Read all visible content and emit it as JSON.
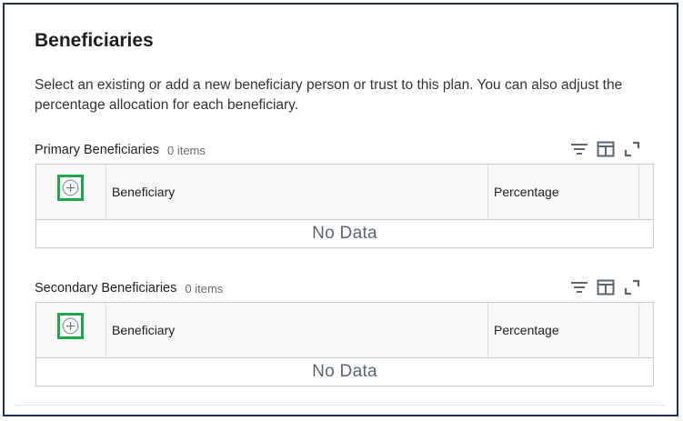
{
  "page": {
    "title": "Beneficiaries",
    "description": "Select an existing or add a new beneficiary person or trust to this plan. You can also adjust the percentage allocation for each beneficiary."
  },
  "primary": {
    "title": "Primary Beneficiaries",
    "count": "0 items",
    "columns": [
      "Beneficiary",
      "Percentage"
    ],
    "empty_text": "No Data"
  },
  "secondary": {
    "title": "Secondary Beneficiaries",
    "count": "0 items",
    "columns": [
      "Beneficiary",
      "Percentage"
    ],
    "empty_text": "No Data"
  },
  "icons": {
    "filter": "filter-icon",
    "columns": "columns-icon",
    "expand": "expand-icon",
    "add": "add-circle-icon"
  },
  "colors": {
    "frame_border": "#1f2f5a",
    "highlight": "#1ea64a",
    "icon": "#5b6670"
  }
}
